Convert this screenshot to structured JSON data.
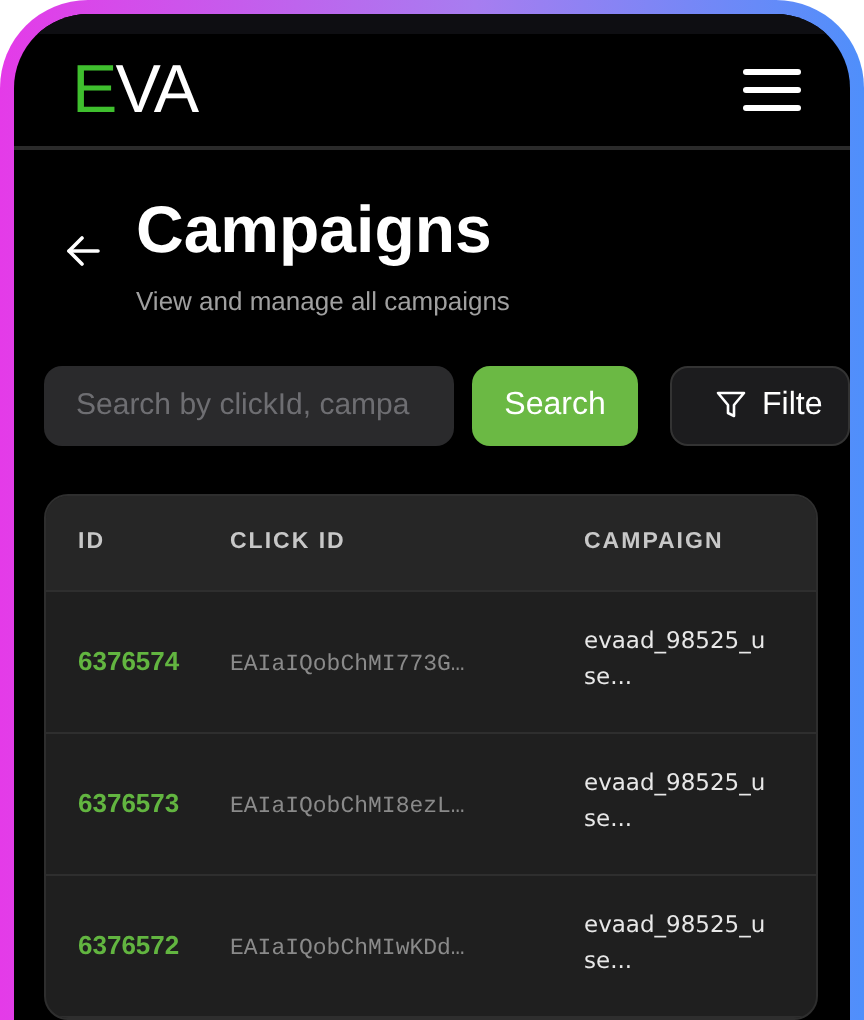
{
  "header": {
    "logo": "EVA"
  },
  "page": {
    "title": "Campaigns",
    "subtitle": "View and manage all campaigns"
  },
  "search": {
    "placeholder": "Search by clickId, campa",
    "button": "Search",
    "filter_button": "Filte"
  },
  "table": {
    "columns": [
      "ID",
      "CLICK ID",
      "CAMPAIGN"
    ],
    "rows": [
      {
        "id": "6376574",
        "click_id": "EAIaIQobChMI773G…",
        "campaign": [
          "evaad_98525_u",
          "se..."
        ]
      },
      {
        "id": "6376573",
        "click_id": "EAIaIQobChMI8ezL…",
        "campaign": [
          "evaad_98525_u",
          "se..."
        ]
      },
      {
        "id": "6376572",
        "click_id": "EAIaIQobChMIwKDd…",
        "campaign": [
          "evaad_98525_u",
          "se..."
        ]
      }
    ]
  }
}
